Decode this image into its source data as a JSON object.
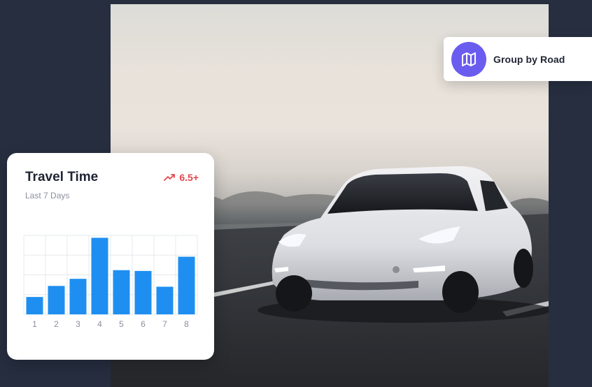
{
  "group_card": {
    "label": "Group by Road",
    "icon": "map-icon",
    "badge_color": "#6b5cf0"
  },
  "travel_card": {
    "title": "Travel Time",
    "subtitle": "Last 7 Days",
    "trend_value": "6.5+",
    "trend_icon": "trending-up-icon",
    "trend_color": "#e5484d"
  },
  "chart_data": {
    "type": "bar",
    "categories": [
      "1",
      "2",
      "3",
      "4",
      "5",
      "6",
      "7",
      "8"
    ],
    "values": [
      22,
      36,
      45,
      97,
      56,
      55,
      35,
      73
    ],
    "ylim": [
      0,
      100
    ],
    "grid": true,
    "bar_color": "#1e8ff0"
  }
}
